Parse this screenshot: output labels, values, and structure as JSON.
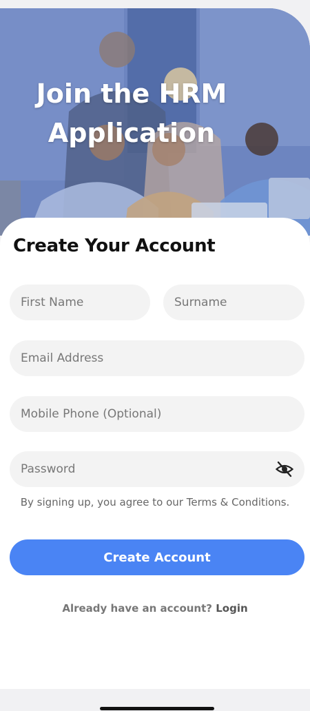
{
  "hero": {
    "title_line1": "Join the HRM",
    "title_line2": "Application"
  },
  "form": {
    "heading": "Create Your Account",
    "first_name_placeholder": "First Name",
    "surname_placeholder": "Surname",
    "email_placeholder": "Email Address",
    "mobile_placeholder": "Mobile Phone (Optional)",
    "password_placeholder": "Password",
    "password_toggle_icon": "eye-slash-icon",
    "terms_text": "By signing up, you agree to our Terms & Conditions.",
    "submit_label": "Create Account",
    "login_prompt": "Already have an account?",
    "login_label": "Login"
  },
  "colors": {
    "primary": "#4a84f4",
    "hero_tint": "#6f86c0",
    "field_bg": "#f3f3f3"
  }
}
